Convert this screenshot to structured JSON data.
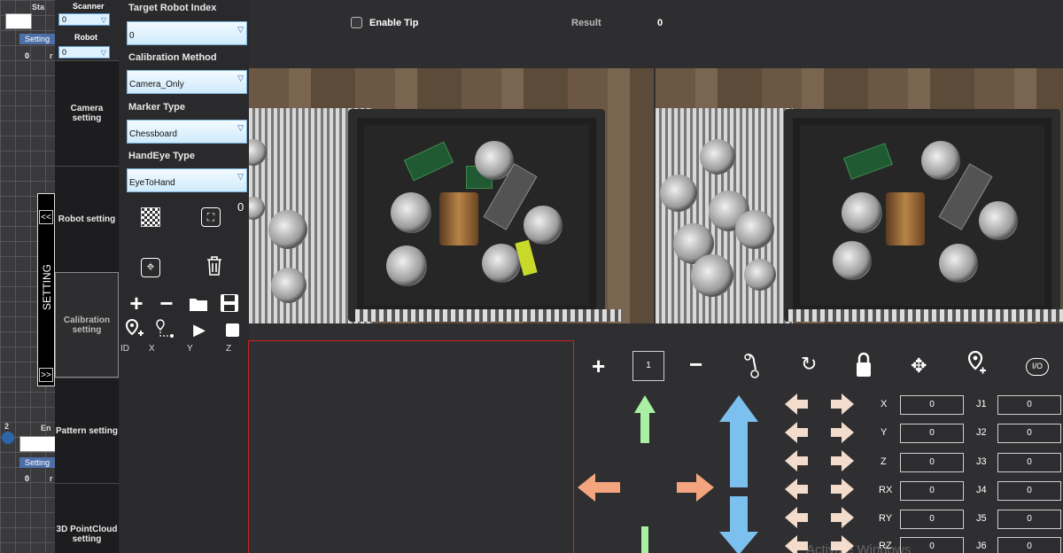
{
  "left_strip": {
    "top_label": "Sta",
    "setting_label": "Setting",
    "setting_suffix": "r",
    "zero": "0",
    "bottom_label": "En",
    "bottom_setting_label": "Setting",
    "bottom_zero": "0",
    "bottom_suffix": "r",
    "marker": "2"
  },
  "selectors": {
    "scanner_label": "Scanner",
    "scanner_value": "0",
    "robot_label": "Robot",
    "robot_value": "0"
  },
  "nav": {
    "camera": "Camera setting",
    "robot": "Robot setting",
    "calibration": "Calibration setting",
    "pattern": "Pattern setting",
    "pointcloud": "3D PointCloud setting"
  },
  "setting_tab": {
    "label": "SETTING",
    "collapse": "<<",
    "expand": ">>"
  },
  "calibration": {
    "target_label": "Target Robot Index",
    "target_value": "0",
    "method_label": "Calibration Method",
    "method_value": "Camera_Only",
    "marker_label": "Marker Type",
    "marker_value": "Chessboard",
    "handeye_label": "HandEye Type",
    "handeye_value": "EyeToHand",
    "count": "0",
    "col_headers": [
      "ID",
      "X",
      "Y",
      "Z"
    ]
  },
  "header": {
    "enable_tip": "Enable Tip",
    "result_label": "Result",
    "result_value": "0"
  },
  "jog": {
    "step_value": "1",
    "cartesian": [
      {
        "axis": "X",
        "value": "0"
      },
      {
        "axis": "Y",
        "value": "0"
      },
      {
        "axis": "Z",
        "value": "0"
      },
      {
        "axis": "RX",
        "value": "0"
      },
      {
        "axis": "RY",
        "value": "0"
      },
      {
        "axis": "RZ",
        "value": "0"
      }
    ],
    "joints": [
      {
        "axis": "J1",
        "value": "0"
      },
      {
        "axis": "J2",
        "value": "0"
      },
      {
        "axis": "J3",
        "value": "0"
      },
      {
        "axis": "J4",
        "value": "0"
      },
      {
        "axis": "J5",
        "value": "0"
      },
      {
        "axis": "J6",
        "value": "0"
      }
    ],
    "io_label": "I/O"
  },
  "watermark": "Activate Windows",
  "colors": {
    "green_arrow": "#a9f0a4",
    "blue_arrow": "#7cc0ef",
    "orange_arrow": "#f4a57e",
    "peach_arrow": "#f3dccb",
    "red_border": "#cc2222"
  }
}
